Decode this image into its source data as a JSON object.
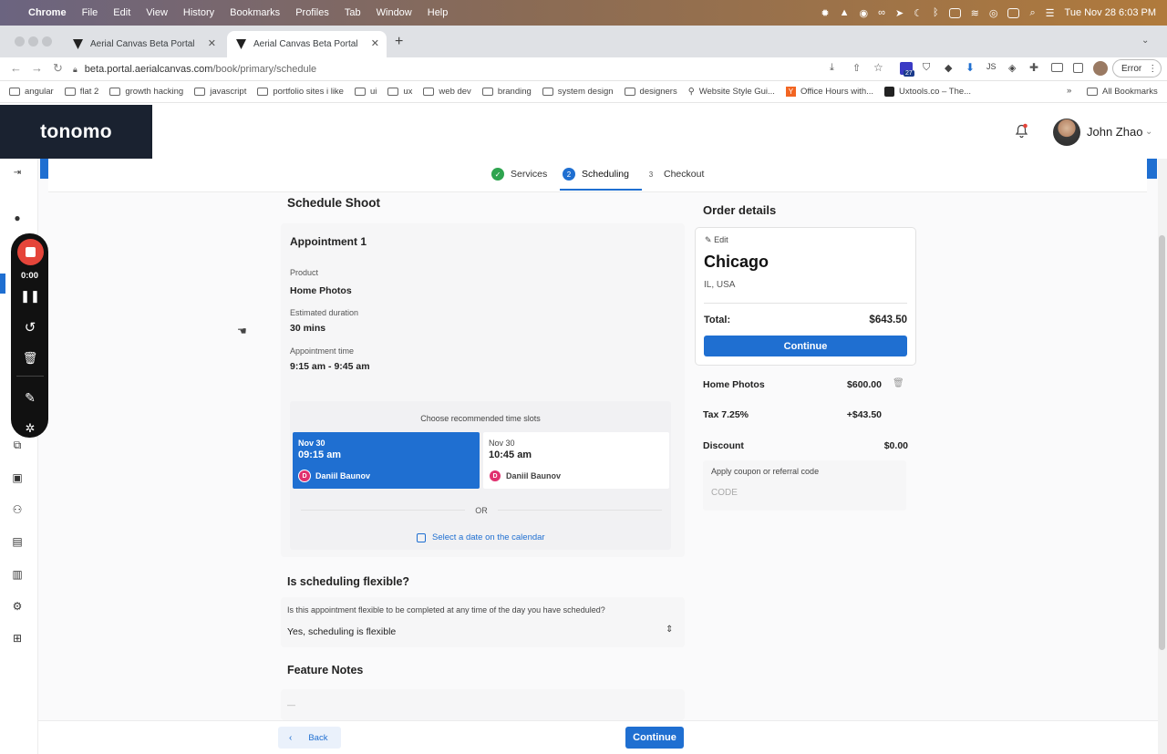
{
  "menubar": {
    "apple": "",
    "app": "Chrome",
    "items": [
      "File",
      "Edit",
      "View",
      "History",
      "Bookmarks",
      "Profiles",
      "Tab",
      "Window",
      "Help"
    ],
    "clock": "Tue Nov 28  6:03 PM"
  },
  "tabs": [
    {
      "title": "Aerial Canvas Beta Portal"
    },
    {
      "title": "Aerial Canvas Beta Portal"
    }
  ],
  "address": {
    "host": "beta.portal.aerialcanvas.com",
    "path": "/book/primary/schedule",
    "error_label": "Error",
    "ext_badge": "27"
  },
  "bookmarks": [
    "angular",
    "flat 2",
    "growth hacking",
    "javascript",
    "portfolio sites i like",
    "ui",
    "ux",
    "web dev",
    "branding",
    "system design",
    "designers",
    "Website Style Gui...",
    "Office Hours with...",
    "Uxtools.co – The...",
    "All Bookmarks"
  ],
  "brand": {
    "logo": "tonomo"
  },
  "user": {
    "name": "John Zhao"
  },
  "recorder": {
    "time": "0:00"
  },
  "stepper": {
    "steps": [
      {
        "num": "✓",
        "label": "Services"
      },
      {
        "num": "2",
        "label": "Scheduling"
      },
      {
        "num": "3",
        "label": "Checkout"
      }
    ]
  },
  "schedule": {
    "title": "Schedule Shoot",
    "appointment_title": "Appointment 1",
    "product_label": "Product",
    "product_value": "Home Photos",
    "duration_label": "Estimated duration",
    "duration_value": "30 mins",
    "time_label": "Appointment time",
    "time_value": "9:15 am - 9:45 am",
    "slots_title": "Choose recommended time slots",
    "slots": [
      {
        "date": "Nov 30",
        "time": "09:15 am",
        "initial": "D",
        "name": "Daniil Baunov",
        "selected": true
      },
      {
        "date": "Nov 30",
        "time": "10:45 am",
        "initial": "D",
        "name": "Daniil Baunov",
        "selected": false
      }
    ],
    "or_label": "OR",
    "calendar_link": "Select a date on the calendar"
  },
  "flexible": {
    "title": "Is scheduling flexible?",
    "question": "Is this appointment flexible to be completed at any time of the day you have scheduled?",
    "selected": "Yes, scheduling is flexible"
  },
  "notes": {
    "title": "Feature Notes",
    "placeholder": "—"
  },
  "order": {
    "title": "Order details",
    "edit_label": "Edit",
    "city": "Chicago",
    "region": "IL, USA",
    "total_label": "Total:",
    "total_value": "$643.50",
    "continue_label": "Continue",
    "lines": [
      {
        "label": "Home Photos",
        "value": "$600.00"
      },
      {
        "label": "Tax 7.25%",
        "value": "+$43.50"
      },
      {
        "label": "Discount",
        "value": "$0.00"
      }
    ],
    "coupon_label": "Apply coupon or referral code",
    "coupon_placeholder": "CODE"
  },
  "footer": {
    "back_label": "Back",
    "continue_label": "Continue"
  },
  "colors": {
    "accent": "#1f6fd1",
    "logo_bg": "#1a2230",
    "success": "#2ea44f",
    "record": "#e5453a"
  }
}
